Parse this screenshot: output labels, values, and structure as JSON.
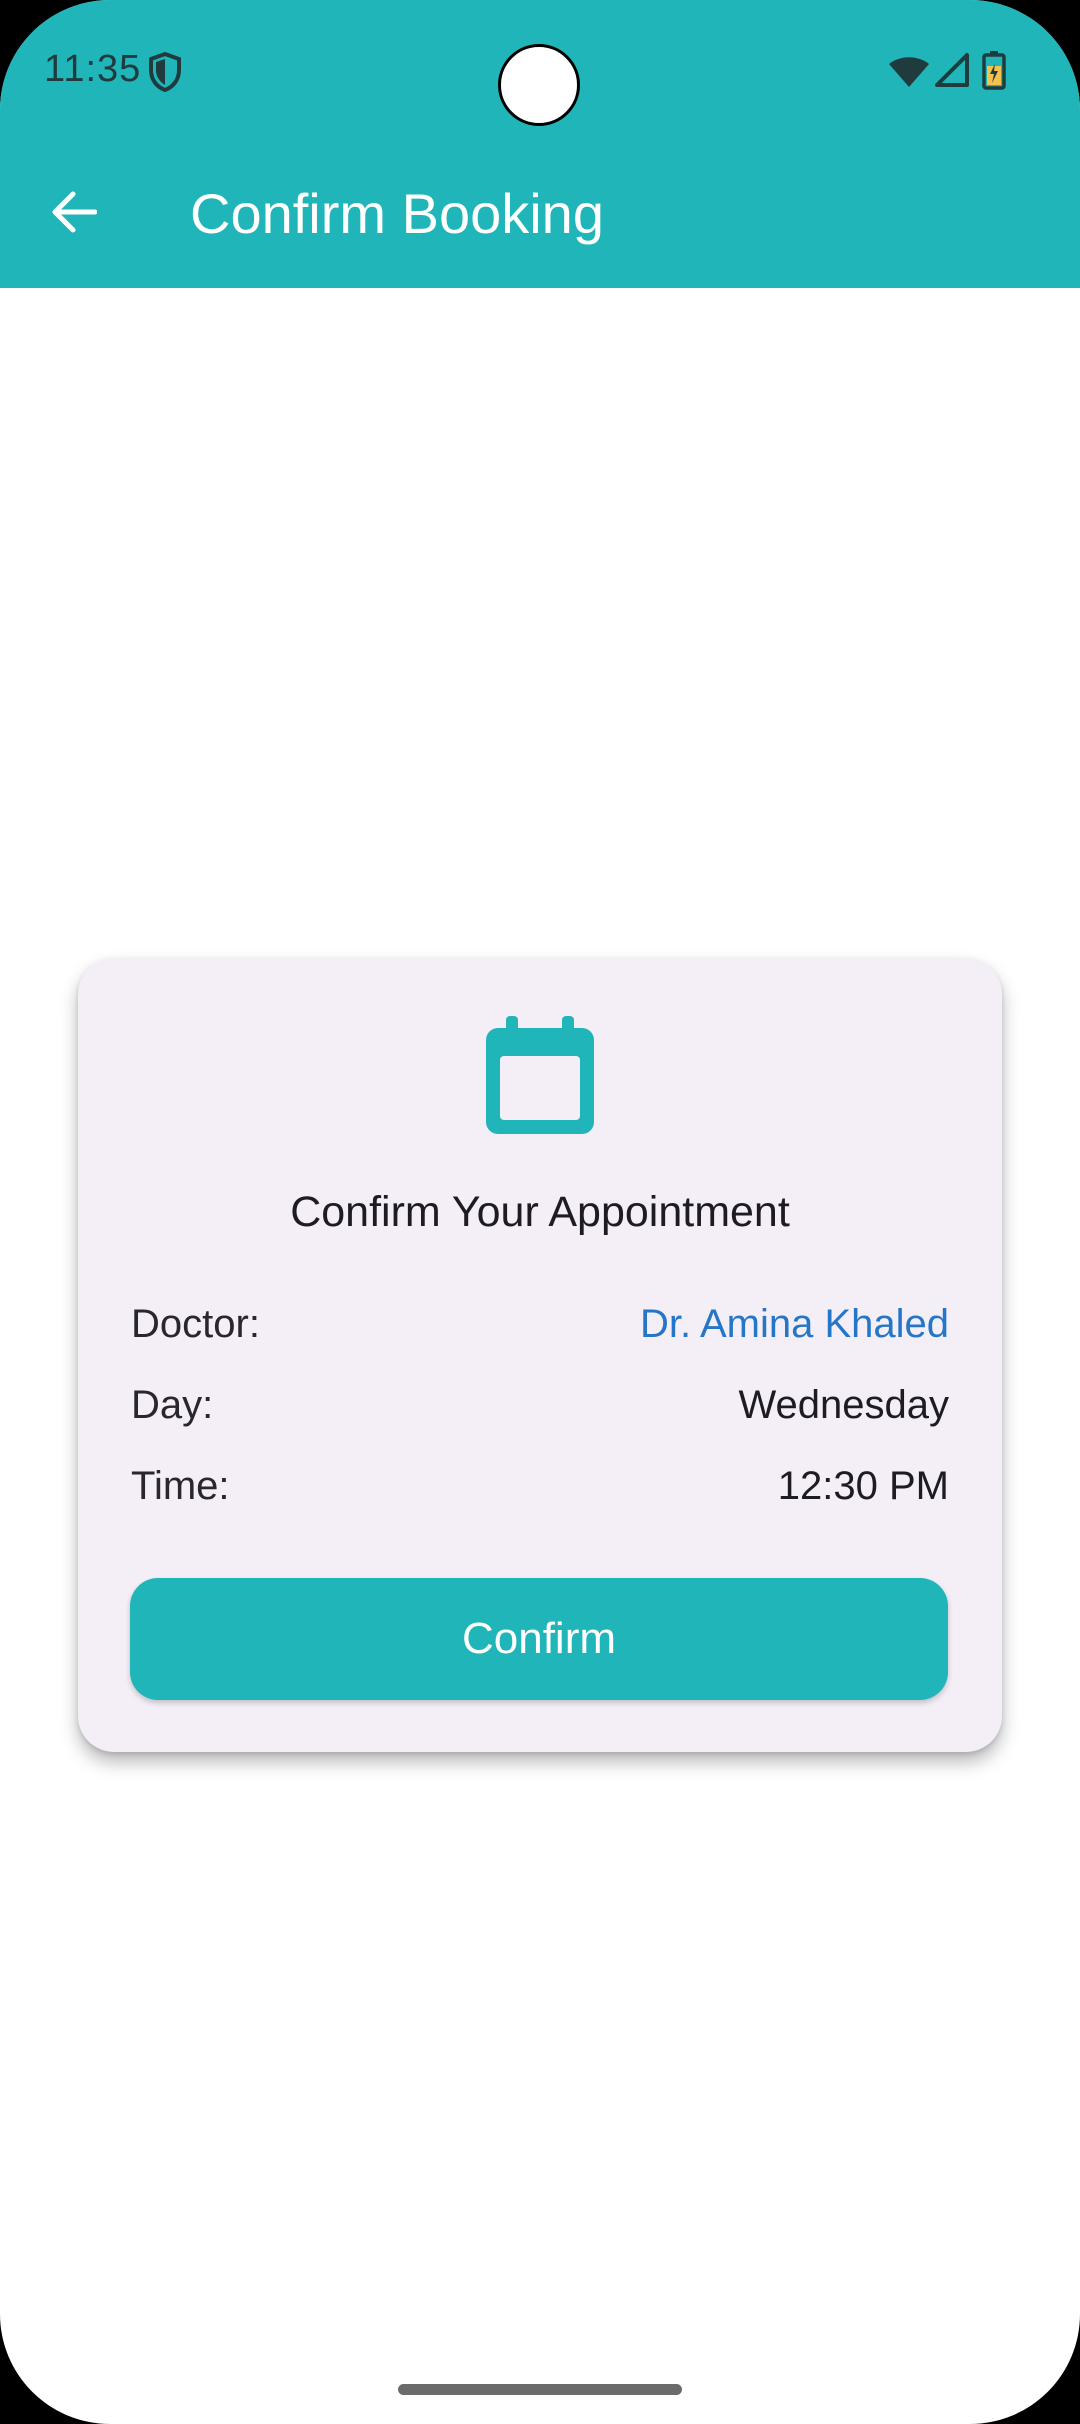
{
  "status_bar": {
    "time": "11:35",
    "icons": [
      "shield-icon",
      "wifi-icon",
      "signal-icon",
      "battery-icon"
    ]
  },
  "app_bar": {
    "back_icon": "arrow-left-icon",
    "title": "Confirm Booking"
  },
  "card": {
    "icon": "calendar-icon",
    "title": "Confirm Your Appointment",
    "details": [
      {
        "label": "Doctor:",
        "value": "Dr. Amina Khaled"
      },
      {
        "label": "Day:",
        "value": "Wednesday"
      },
      {
        "label": "Time:",
        "value": "12:30 PM"
      }
    ],
    "confirm_label": "Confirm"
  },
  "colors": {
    "primary": "#20b5b8",
    "card_background": "#f4eff7",
    "doctor_name": "#2676c8",
    "text": "#1e1b22"
  }
}
